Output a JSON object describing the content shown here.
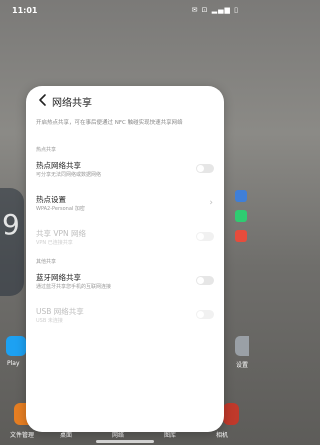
{
  "status_bar": {
    "time": "11:01",
    "icons": "✉ ⊡ ▂▄▆ ▯"
  },
  "background": {
    "widget_number": "9",
    "left_app_label": "Play",
    "right_app_label": "设置",
    "dock": {
      "label_1": "文件管理",
      "label_2": "桌面",
      "label_3": "网络",
      "label_4": "图库",
      "label_5": "相机"
    }
  },
  "card": {
    "title": "网络共享",
    "intro": "开启热点共享，可在事后便通过 NFC 触碰实现快速共享网络",
    "section_hotspot": "热点共享",
    "hotspot_share": {
      "title": "热点网络共享",
      "sub": "可分享无法同网络或数据网络"
    },
    "hotspot_settings": {
      "title": "热点设置",
      "sub": "WPA2-Personal 加密"
    },
    "vpn_share": {
      "title": "共享 VPN 网络",
      "sub": "VPN 已连接共享"
    },
    "section_other": "其他共享",
    "bluetooth_share": {
      "title": "蓝牙网络共享",
      "sub": "通过蓝牙共享您手机的互联网连接"
    },
    "usb_share": {
      "title": "USB 网络共享",
      "sub": "USB 未连接"
    }
  }
}
